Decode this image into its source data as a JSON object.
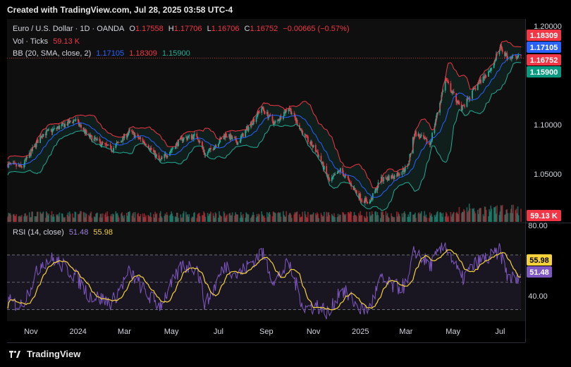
{
  "header": {
    "created": "Created with TradingView.com, Jul 28, 2025 03:58 UTC-4"
  },
  "legend": {
    "symbol": "Euro / U.S. Dollar · 1D · OANDA",
    "o_label": "O",
    "o_value": "1.17558",
    "h_label": "H",
    "h_value": "1.17706",
    "l_label": "L",
    "l_value": "1.16706",
    "c_label": "C",
    "c_value": "1.16752",
    "change": "−0.00665 (−0.57%)",
    "vol_label": "Vol · Ticks",
    "vol_value": "59.13 K",
    "bb_label": "BB (20, SMA, close, 2)",
    "bb_mid": "1.17105",
    "bb_upper": "1.18309",
    "bb_lower": "1.15900"
  },
  "rsi_legend": {
    "label": "RSI (14, close)",
    "rsi": "51.48",
    "ma": "55.98"
  },
  "footer": {
    "brand": "TradingView"
  },
  "colors": {
    "up": "#22ab94",
    "down": "#f23645",
    "bb_mid": "#2962ff",
    "bb_band": "#f23645",
    "bb_lower": "#22ab94",
    "rsi": "#7e57c2",
    "rsi_ma": "#f5d23a"
  },
  "chart_data": [
    {
      "type": "candlestick",
      "title": "Euro / U.S. Dollar · 1D · OANDA",
      "x_tick_labels": [
        "Nov",
        "2024",
        "Mar",
        "May",
        "Jul",
        "Sep",
        "Nov",
        "2025",
        "Mar",
        "May",
        "Jul"
      ],
      "y_tick_labels": [
        "1.20000",
        "1.10000",
        "1.05000"
      ],
      "ylim": [
        1.02,
        1.205
      ],
      "price_badges": [
        {
          "label": "1.18309",
          "value": 1.18309,
          "color": "#f23645"
        },
        {
          "label": "1.17105",
          "value": 1.17105,
          "color": "#2962ff"
        },
        {
          "label": "1.16752",
          "value": 1.16752,
          "color": "#f23645"
        },
        {
          "label": "1.15900",
          "value": 1.159,
          "color": "#089981"
        }
      ],
      "close_path_approx": {
        "x": [
          "2023-10-01",
          "2023-10-20",
          "2023-11-15",
          "2023-12-01",
          "2023-12-28",
          "2024-01-15",
          "2024-02-14",
          "2024-03-08",
          "2024-04-01",
          "2024-04-16",
          "2024-05-15",
          "2024-06-03",
          "2024-06-14",
          "2024-07-10",
          "2024-07-26",
          "2024-08-26",
          "2024-09-12",
          "2024-09-30",
          "2024-10-20",
          "2024-11-06",
          "2024-11-22",
          "2024-12-06",
          "2025-01-02",
          "2025-01-13",
          "2025-01-27",
          "2025-02-14",
          "2025-03-03",
          "2025-03-12",
          "2025-04-01",
          "2025-04-21",
          "2025-05-12",
          "2025-06-02",
          "2025-06-20",
          "2025-07-01",
          "2025-07-10",
          "2025-07-25"
        ],
        "close": [
          1.06,
          1.057,
          1.09,
          1.095,
          1.105,
          1.088,
          1.075,
          1.093,
          1.079,
          1.063,
          1.086,
          1.089,
          1.069,
          1.09,
          1.082,
          1.117,
          1.101,
          1.118,
          1.089,
          1.072,
          1.042,
          1.054,
          1.025,
          1.021,
          1.044,
          1.048,
          1.057,
          1.092,
          1.08,
          1.146,
          1.115,
          1.141,
          1.158,
          1.178,
          1.169,
          1.168
        ]
      },
      "bollinger_bands": {
        "length": 20,
        "source": "close",
        "stdev": 2,
        "upper": 1.18309,
        "basis": 1.17105,
        "lower": 1.159
      },
      "volume": {
        "label": "Vol · Ticks",
        "last": "59.13 K"
      }
    },
    {
      "type": "line",
      "title": "RSI (14, close)",
      "ylim": [
        20,
        80
      ],
      "y_tick_labels": [
        "80.00",
        "40.00"
      ],
      "levels": [
        70,
        50,
        30
      ],
      "series": [
        {
          "name": "RSI",
          "last": 51.48
        },
        {
          "name": "MA",
          "last": 55.98
        }
      ],
      "rsi_path_approx": {
        "x": [
          "2023-10-01",
          "2023-10-20",
          "2023-11-15",
          "2023-12-01",
          "2023-12-28",
          "2024-01-15",
          "2024-02-14",
          "2024-03-08",
          "2024-04-01",
          "2024-04-16",
          "2024-05-15",
          "2024-06-03",
          "2024-06-14",
          "2024-07-10",
          "2024-07-26",
          "2024-08-26",
          "2024-09-12",
          "2024-09-30",
          "2024-10-20",
          "2024-11-06",
          "2024-11-22",
          "2024-12-06",
          "2025-01-02",
          "2025-01-13",
          "2025-01-27",
          "2025-02-14",
          "2025-03-03",
          "2025-03-12",
          "2025-04-01",
          "2025-04-21",
          "2025-05-12",
          "2025-06-02",
          "2025-06-20",
          "2025-07-01",
          "2025-07-10",
          "2025-07-25"
        ],
        "values": [
          36,
          33,
          65,
          67,
          55,
          41,
          35,
          58,
          40,
          33,
          62,
          61,
          33,
          63,
          55,
          72,
          50,
          64,
          31,
          33,
          27,
          46,
          30,
          31,
          52,
          46,
          48,
          74,
          62,
          78,
          52,
          65,
          69,
          73,
          55,
          51
        ]
      }
    }
  ]
}
